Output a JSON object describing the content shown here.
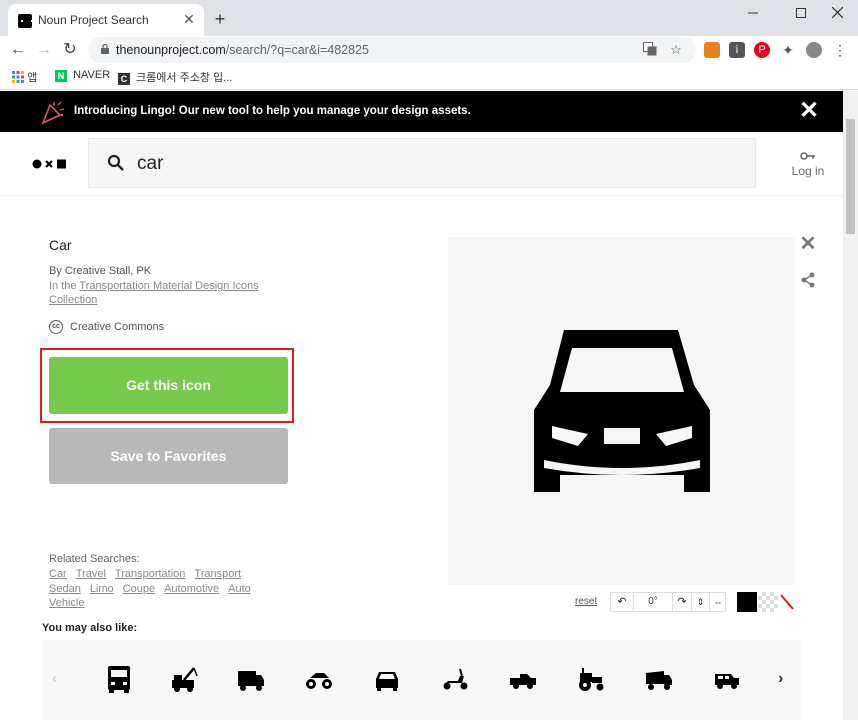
{
  "browser": {
    "tab_title": "Noun Project Search",
    "tab_close": "✕",
    "new_tab": "+",
    "url_domain": "thenounproject.com",
    "url_path": "/search/?q=car&i=482825",
    "bookmarks": [
      {
        "icon": "apps-icon",
        "label": "앱"
      },
      {
        "icon": "naver-icon",
        "label": "NAVER"
      },
      {
        "icon": "chrome-web-icon",
        "label": "크롬에서 주소창 입..."
      }
    ]
  },
  "banner": {
    "text": "Introducing Lingo! Our new tool to help you manage your design assets.",
    "close": "✕"
  },
  "header": {
    "logo": "●×■",
    "search_value": "car",
    "login_label": "Log in"
  },
  "icon_detail": {
    "title": "Car",
    "byline": "By Creative Stall, PK",
    "in_the": "In the",
    "collection_link": "Transportation Material Design Icons Collection",
    "license_badge": "cc",
    "license": "Creative Commons",
    "get_button": "Get this icon",
    "favorite_button": "Save to Favorites",
    "related_label": "Related Searches:",
    "related_tags": [
      "Car",
      "Travel",
      "Transportation",
      "Transport",
      "Sedan",
      "Limo",
      "Coupe",
      "Automotive",
      "Auto",
      "Vehicle"
    ]
  },
  "editor": {
    "reset_label": "reset",
    "rotation": "0°",
    "colors": {
      "icon": "#000000",
      "accent": "#76c94a",
      "highlight": "#e01b1b"
    }
  },
  "also_like": {
    "label": "You may also like:",
    "items": [
      "bus-icon",
      "tow-truck-icon",
      "truck-icon",
      "atv-icon",
      "car-icon",
      "scooter-icon",
      "pickup-icon",
      "tractor-icon",
      "dump-truck-icon",
      "jeep-icon"
    ]
  }
}
